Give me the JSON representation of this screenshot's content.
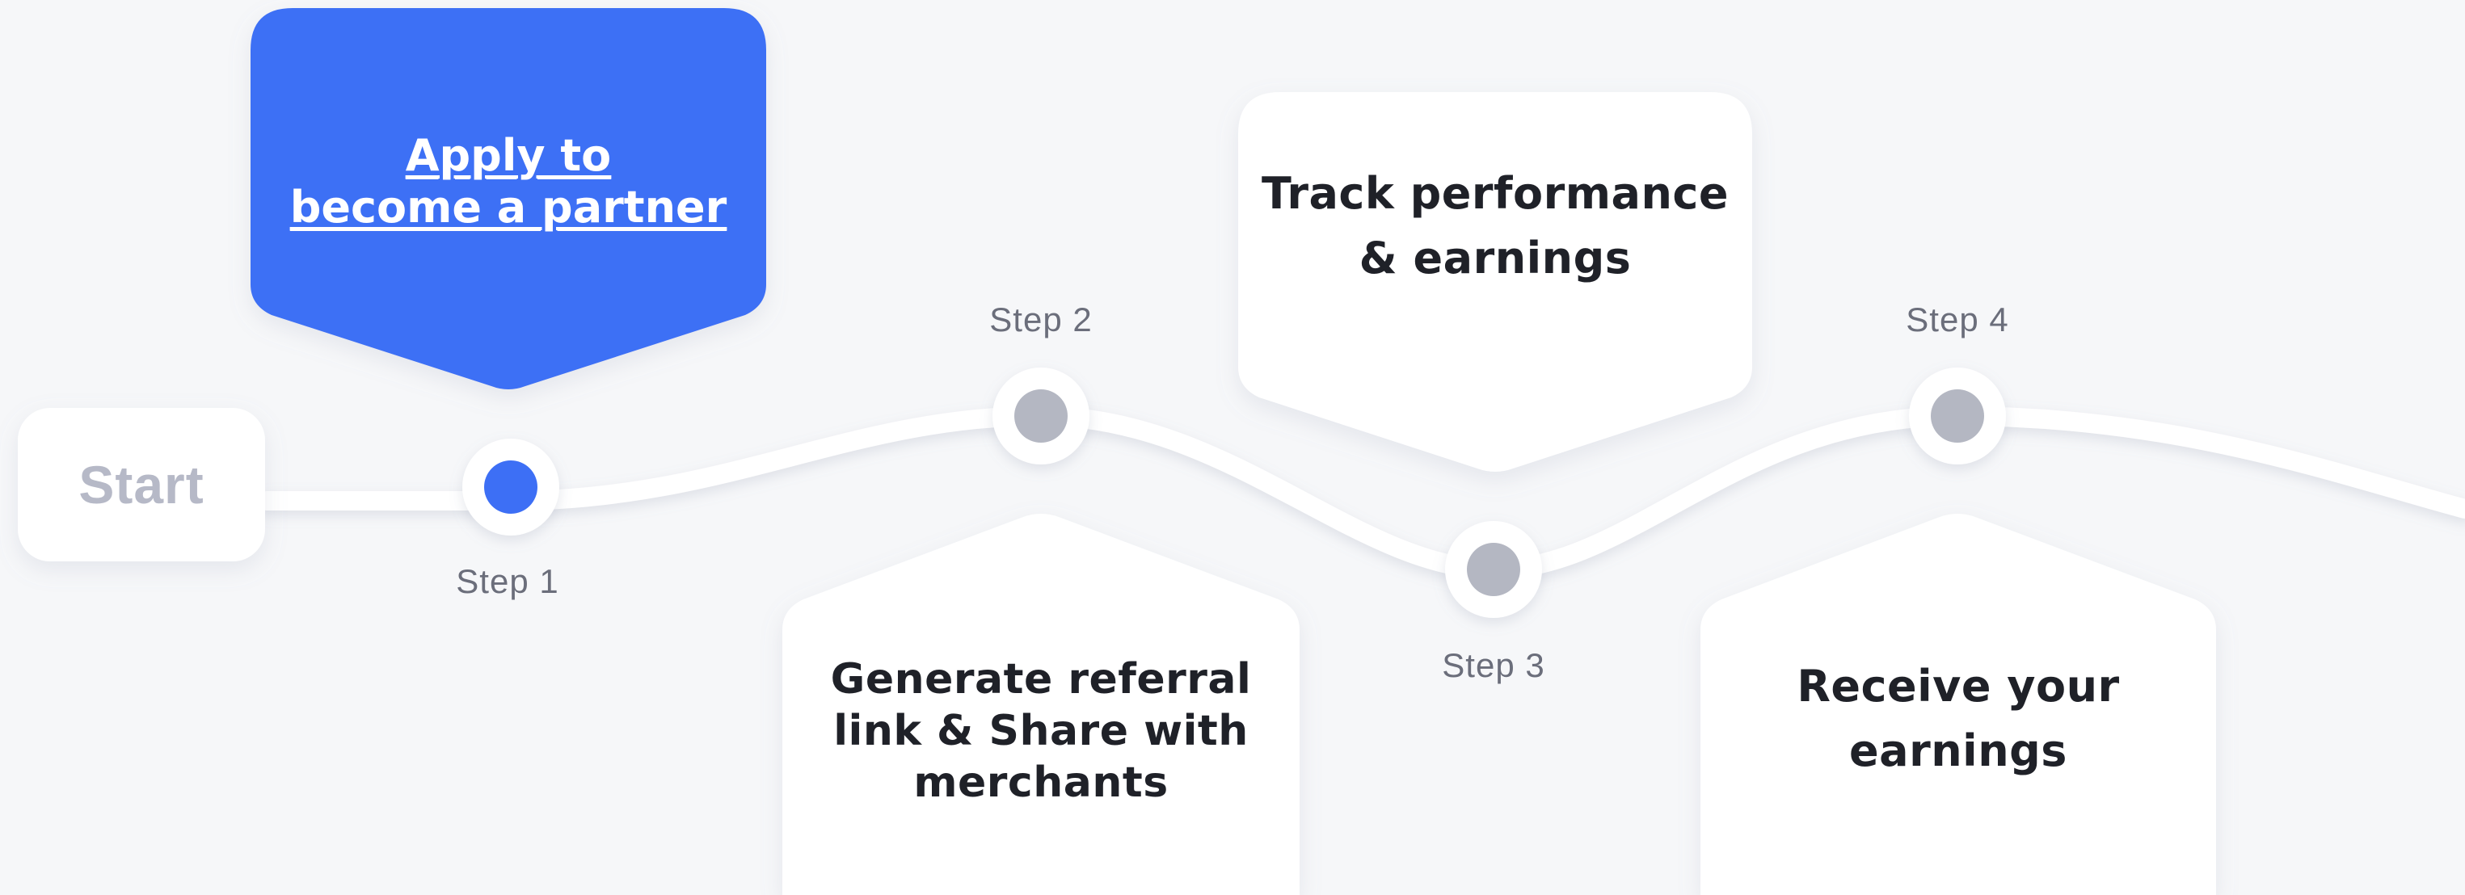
{
  "start": {
    "label": "Start"
  },
  "steps": [
    {
      "label": "Step 1",
      "card_lines": [
        "Apply to",
        "become a partner"
      ],
      "active": true,
      "is_link": true
    },
    {
      "label": "Step 2",
      "card_lines": [
        "Generate referral",
        "link & Share with",
        "merchants"
      ],
      "active": false
    },
    {
      "label": "Step 3",
      "card_lines": [
        "Track performance",
        "& earnings"
      ],
      "active": false
    },
    {
      "label": "Step 4",
      "card_lines": [
        "Receive your",
        "earnings"
      ],
      "active": false
    }
  ],
  "colors": {
    "accent": "#3d6ff5",
    "inactive_node": "#b4b7c2",
    "card": "#ffffff",
    "background": "#f6f7f9",
    "text_dark": "#1f2128",
    "text_muted": "#6b6e7b"
  }
}
